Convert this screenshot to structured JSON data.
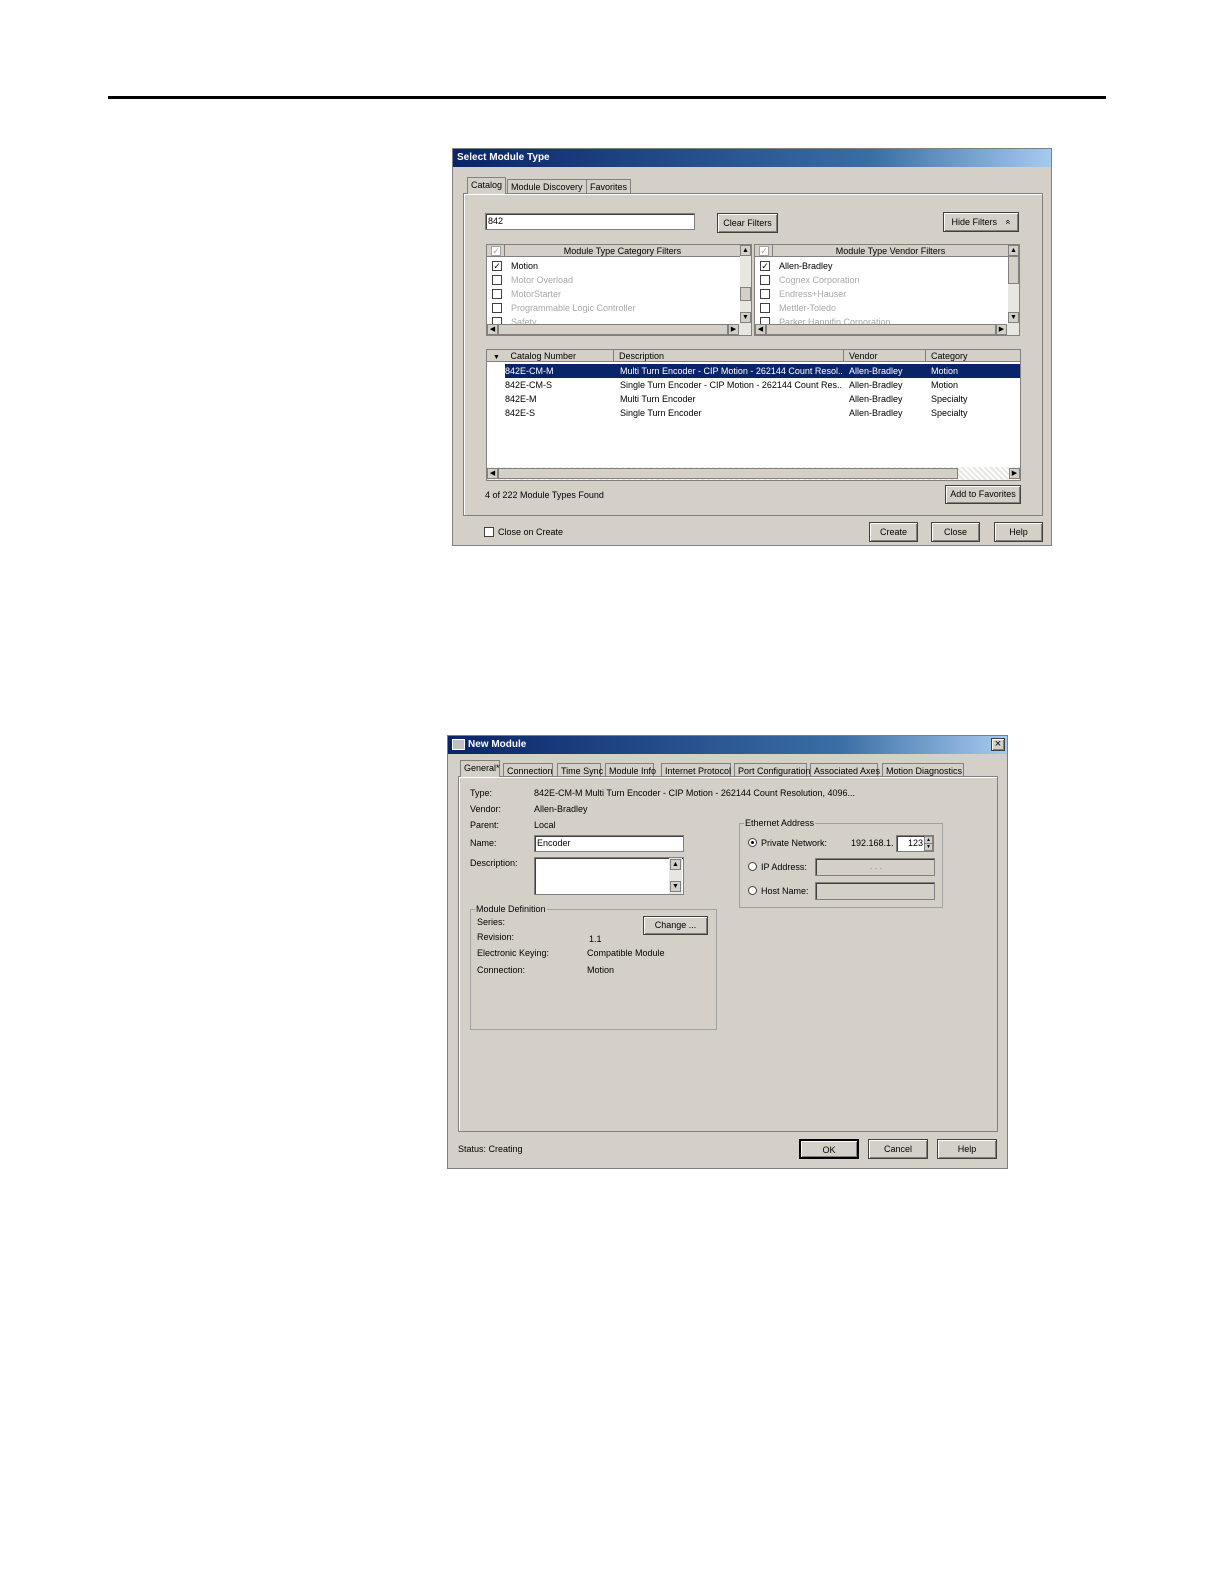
{
  "select_module": {
    "title": "Select Module Type",
    "tabs": [
      "Catalog",
      "Module Discovery",
      "Favorites"
    ],
    "search_value": "842",
    "clear_filters": "Clear Filters",
    "hide_filters": "Hide Filters",
    "hide_filters_icon": "«",
    "category_filter_header": "Module Type Category Filters",
    "category_filters": [
      {
        "label": "Motion",
        "checked": true,
        "enabled": true
      },
      {
        "label": "Motor Overload",
        "checked": false,
        "enabled": false
      },
      {
        "label": "MotorStarter",
        "checked": false,
        "enabled": false
      },
      {
        "label": "Programmable Logic Controller",
        "checked": false,
        "enabled": false
      },
      {
        "label": "Safety",
        "checked": false,
        "enabled": false
      }
    ],
    "vendor_filter_header": "Module Type Vendor Filters",
    "vendor_filters": [
      {
        "label": "Allen-Bradley",
        "checked": true,
        "enabled": true
      },
      {
        "label": "Cognex Corporation",
        "checked": false,
        "enabled": false
      },
      {
        "label": "Endress+Hauser",
        "checked": false,
        "enabled": false
      },
      {
        "label": "Mettler-Toledo",
        "checked": false,
        "enabled": false
      },
      {
        "label": "Parker Hannifin Corporation",
        "checked": false,
        "enabled": false
      }
    ],
    "columns": [
      "Catalog Number",
      "Description",
      "Vendor",
      "Category"
    ],
    "rows": [
      {
        "catalog": "842E-CM-M",
        "description": "Multi Turn Encoder - CIP Motion - 262144 Count Resol...",
        "vendor": "Allen-Bradley",
        "category": "Motion",
        "selected": true
      },
      {
        "catalog": "842E-CM-S",
        "description": "Single Turn Encoder - CIP Motion - 262144 Count Res...",
        "vendor": "Allen-Bradley",
        "category": "Motion",
        "selected": false
      },
      {
        "catalog": "842E-M",
        "description": "Multi Turn Encoder",
        "vendor": "Allen-Bradley",
        "category": "Specialty",
        "selected": false
      },
      {
        "catalog": "842E-S",
        "description": "Single Turn Encoder",
        "vendor": "Allen-Bradley",
        "category": "Specialty",
        "selected": false
      }
    ],
    "found_text": "4  of 222 Module Types Found",
    "add_to_favorites": "Add to Favorites",
    "close_on_create": "Close on Create",
    "create": "Create",
    "close": "Close",
    "help": "Help"
  },
  "new_module": {
    "title": "New Module",
    "close_icon": "×",
    "tabs": [
      "General*",
      "Connection",
      "Time Sync",
      "Module Info",
      "Internet Protocol",
      "Port Configuration",
      "Associated Axes",
      "Motion Diagnostics"
    ],
    "type_label": "Type:",
    "type_value": "842E-CM-M Multi Turn Encoder - CIP Motion - 262144 Count Resolution, 4096...",
    "vendor_label": "Vendor:",
    "vendor_value": "Allen-Bradley",
    "parent_label": "Parent:",
    "parent_value": "Local",
    "name_label": "Name:",
    "name_value": "Encoder",
    "description_label": "Description:",
    "ethernet_legend": "Ethernet Address",
    "private_network": "Private Network:",
    "private_prefix": "192.168.1.",
    "private_value": "123",
    "ip_address": "IP Address:",
    "ip_dots": ".        .        .",
    "host_name": "Host Name:",
    "module_def_legend": "Module Definition",
    "series_label": "Series:",
    "change_button": "Change ...",
    "revision_label": "Revision:",
    "revision_value": "1.1",
    "keying_label": "Electronic Keying:",
    "keying_value": "Compatible Module",
    "connection_label": "Connection:",
    "connection_value": "Motion",
    "status_label": "Status:  Creating",
    "ok": "OK",
    "cancel": "Cancel",
    "help": "Help"
  }
}
